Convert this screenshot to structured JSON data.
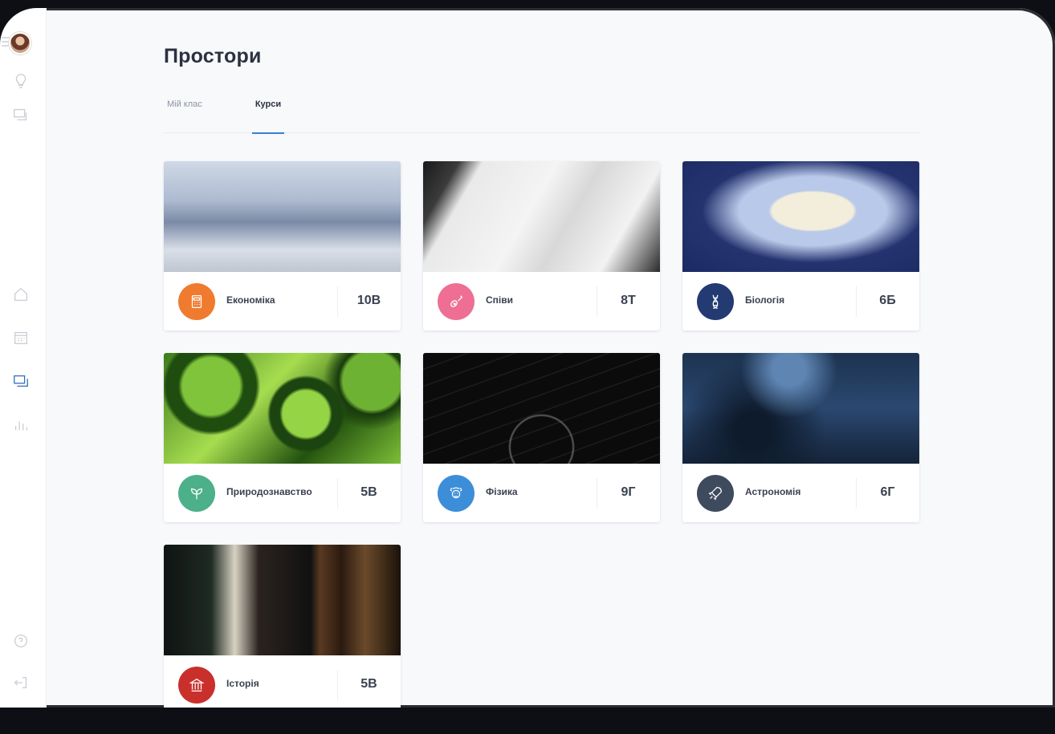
{
  "page": {
    "title": "Простори"
  },
  "tabs": [
    {
      "label": "Мій клас",
      "active": false
    },
    {
      "label": "Курси",
      "active": true
    }
  ],
  "sidebar": {
    "top_icons": [
      "menu-icon",
      "avatar",
      "lightbulb-icon",
      "monitor-icon"
    ],
    "middle_icons": [
      "home-icon",
      "calendar-icon",
      "spaces-icon",
      "stats-icon"
    ],
    "bottom_icons": [
      "help-icon",
      "logout-icon"
    ],
    "active": "spaces-icon"
  },
  "courses": [
    {
      "name": "Економіка",
      "code": "10В",
      "color": "#f07a2e",
      "icon": "calculator-icon"
    },
    {
      "name": "Співи",
      "code": "8Т",
      "color": "#ee6f93",
      "icon": "guitar-icon"
    },
    {
      "name": "Біологія",
      "code": "6Б",
      "color": "#243a73",
      "icon": "dna-icon"
    },
    {
      "name": "Природознавство",
      "code": "5В",
      "color": "#4cb08a",
      "icon": "leaf-icon"
    },
    {
      "name": "Фізика",
      "code": "9Г",
      "color": "#3d8ed9",
      "icon": "einstein-icon"
    },
    {
      "name": "Астрономія",
      "code": "6Г",
      "color": "#3e4a5e",
      "icon": "rocket-icon"
    },
    {
      "name": "Історія",
      "code": "5В",
      "color": "#c9302c",
      "icon": "museum-icon"
    }
  ],
  "colors": {
    "accent": "#3a7bd5",
    "title": "#2b3140"
  }
}
